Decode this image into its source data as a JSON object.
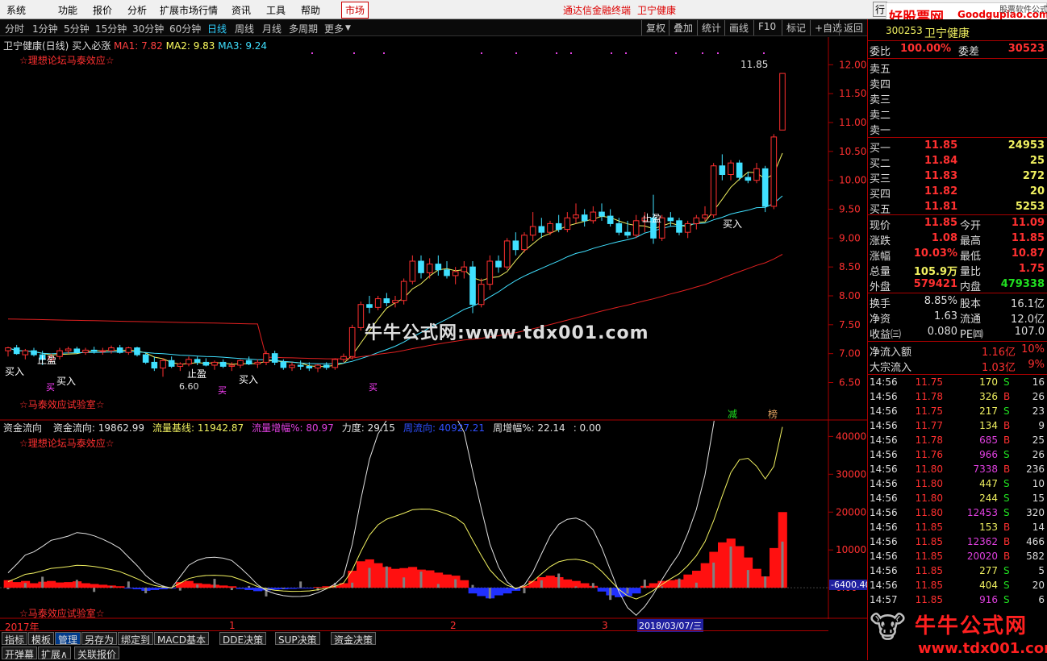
{
  "menu": {
    "items": [
      "系统",
      "功能",
      "报价",
      "分析",
      "扩展市场行情",
      "资讯",
      "工具",
      "帮助"
    ],
    "market": "市场",
    "center_title": "通达信金融终端",
    "center_stock": "卫宁健康",
    "right_button": "行",
    "logo_text": "好股票网",
    "logo_url": "Goodgupiao.com",
    "logo_sub": "股票软件公式"
  },
  "toolbar": {
    "periods": [
      "分时",
      "1分钟",
      "5分钟",
      "15分钟",
      "30分钟",
      "60分钟",
      "日线",
      "周线",
      "月线",
      "多周期",
      "更多"
    ],
    "active_period": "日线",
    "right_buttons": [
      "复权",
      "叠加",
      "统计",
      "画线",
      "F10",
      "标记",
      "+自选",
      "返回"
    ]
  },
  "chart_header": {
    "stock": "卫宁健康(日线)",
    "indicator": "买入必涨",
    "ma1": "MA1: 7.82",
    "ma2": "MA2: 9.83",
    "ma3": "MA3: 9.24",
    "forum": "☆理想论坛马泰效应☆",
    "lab": "☆马泰效应试验室☆",
    "watermark": "牛牛公式网:www.tdx001.com",
    "peak": "11.85",
    "low": "6.60",
    "tag_jian": "减",
    "tag_bang": "榜"
  },
  "price_axis": [
    "12.00",
    "11.50",
    "11.00",
    "10.50",
    "10.00",
    "9.50",
    "9.00",
    "8.50",
    "8.00",
    "7.50",
    "7.00",
    "6.50"
  ],
  "signals": {
    "buy": "买入",
    "stop": "止盈",
    "short_buy": "买"
  },
  "sub_header": {
    "name": "资金流向",
    "items": [
      {
        "text": "资金流向: 19862.99",
        "color": "#e0e0e0"
      },
      {
        "text": "流量基线: 11942.87",
        "color": "#f0f060"
      },
      {
        "text": "流量增幅%: 80.97",
        "color": "#e040e0"
      },
      {
        "text": "力度: 29.15",
        "color": "#e0e0e0"
      },
      {
        "text": "周流向: 40927.21",
        "color": "#3050ff"
      },
      {
        "text": "周增幅%: 22.14",
        "color": "#e0e0e0"
      },
      {
        "text": ": 0.00",
        "color": "#e0e0e0"
      }
    ],
    "forum": "☆理想论坛马泰效应☆",
    "lab": "☆马泰效应试验室☆"
  },
  "sub_axis": [
    "40000",
    "30000",
    "20000",
    "10000",
    "0.00"
  ],
  "sub_axis_neg": "-6400.40",
  "date_axis": {
    "year": "2017年",
    "m1": "1",
    "m2": "2",
    "m3": "3",
    "cursor": "2018/03/07/三"
  },
  "bottom_tabs": [
    "指标",
    "模板",
    "管理",
    "另存为",
    "绑定到",
    "MACD基本",
    "DDE决策",
    "SUP决策",
    "资金决策"
  ],
  "bottom_tabs2": [
    "开弹幕",
    "扩展∧",
    "关联报价"
  ],
  "quote": {
    "code": "300253",
    "name": "卫宁健康",
    "weibi_label": "委比",
    "weibi": "100.00%",
    "weicha_label": "委差",
    "weicha": "30523",
    "sells": [
      "卖五",
      "卖四",
      "卖三",
      "卖二",
      "卖一"
    ],
    "buys": [
      {
        "label": "买一",
        "price": "11.85",
        "vol": "24953"
      },
      {
        "label": "买二",
        "price": "11.84",
        "vol": "25"
      },
      {
        "label": "买三",
        "price": "11.83",
        "vol": "272"
      },
      {
        "label": "买四",
        "price": "11.82",
        "vol": "20"
      },
      {
        "label": "买五",
        "price": "11.81",
        "vol": "5253"
      }
    ],
    "stats": [
      {
        "l1": "现价",
        "v1": "11.85",
        "l2": "今开",
        "v2": "11.09",
        "c1": "#ff3030",
        "c2": "#ff3030"
      },
      {
        "l1": "涨跌",
        "v1": "1.08",
        "l2": "最高",
        "v2": "11.85",
        "c1": "#ff3030",
        "c2": "#ff3030"
      },
      {
        "l1": "涨幅",
        "v1": "10.03%",
        "l2": "最低",
        "v2": "10.87",
        "c1": "#ff3030",
        "c2": "#ff3030"
      },
      {
        "l1": "总量",
        "v1": "105.9万",
        "l2": "量比",
        "v2": "1.75",
        "c1": "#f0f060",
        "c2": "#ff3030"
      },
      {
        "l1": "外盘",
        "v1": "579421",
        "l2": "内盘",
        "v2": "479338",
        "c1": "#ff3030",
        "c2": "#20e020"
      }
    ],
    "stats2": [
      {
        "l1": "换手",
        "v1": "8.85%",
        "l2": "股本",
        "v2": "16.1亿"
      },
      {
        "l1": "净资",
        "v1": "1.63",
        "l2": "流通",
        "v2": "12.0亿"
      },
      {
        "l1": "收益㈢",
        "v1": "0.080",
        "l2": "PE㈣",
        "v2": "107.0"
      }
    ],
    "flow": [
      {
        "label": "净流入额",
        "v": "1.16亿",
        "p": "10%"
      },
      {
        "label": "大宗流入",
        "v": "1.03亿",
        "p": "9%"
      }
    ],
    "ticks": [
      [
        "14:56",
        "11.75",
        "170",
        "S",
        "16"
      ],
      [
        "14:56",
        "11.78",
        "326",
        "B",
        "26"
      ],
      [
        "14:56",
        "11.75",
        "217",
        "S",
        "23"
      ],
      [
        "14:56",
        "11.77",
        "134",
        "B",
        "9"
      ],
      [
        "14:56",
        "11.78",
        "685",
        "B",
        "25"
      ],
      [
        "14:56",
        "11.76",
        "966",
        "S",
        "26"
      ],
      [
        "14:56",
        "11.80",
        "7338",
        "B",
        "236"
      ],
      [
        "14:56",
        "11.80",
        "447",
        "S",
        "10"
      ],
      [
        "14:56",
        "11.80",
        "244",
        "S",
        "15"
      ],
      [
        "14:56",
        "11.80",
        "12453",
        "S",
        "320"
      ],
      [
        "14:56",
        "11.85",
        "153",
        "B",
        "14"
      ],
      [
        "14:56",
        "11.85",
        "12362",
        "B",
        "466"
      ],
      [
        "14:56",
        "11.85",
        "20020",
        "B",
        "582"
      ],
      [
        "14:56",
        "11.85",
        "277",
        "S",
        "5"
      ],
      [
        "14:56",
        "11.85",
        "404",
        "S",
        "20"
      ],
      [
        "14:57",
        "11.85",
        "916",
        "S",
        "6"
      ]
    ],
    "footer_logo": "牛牛公式网",
    "footer_url": "www.tdx001.com"
  },
  "chart_data": {
    "type": "candlestick",
    "title": "卫宁健康(日线)",
    "ylim": [
      6.2,
      12.2
    ],
    "candles": [
      [
        7.05,
        7.12,
        6.95,
        7.1
      ],
      [
        7.1,
        7.15,
        6.98,
        7.0
      ],
      [
        6.98,
        7.08,
        6.9,
        7.05
      ],
      [
        7.05,
        7.1,
        6.95,
        6.98
      ],
      [
        6.98,
        7.05,
        6.8,
        6.9
      ],
      [
        6.9,
        7.0,
        6.85,
        6.95
      ],
      [
        6.95,
        7.1,
        6.9,
        7.05
      ],
      [
        7.05,
        7.12,
        7.0,
        7.08
      ],
      [
        7.08,
        7.12,
        7.0,
        7.02
      ],
      [
        7.02,
        7.1,
        6.98,
        7.06
      ],
      [
        7.06,
        7.12,
        7.0,
        7.04
      ],
      [
        7.04,
        7.1,
        6.98,
        7.05
      ],
      [
        7.05,
        7.14,
        7.0,
        7.1
      ],
      [
        7.1,
        7.15,
        7.0,
        7.02
      ],
      [
        7.02,
        7.12,
        6.98,
        7.1
      ],
      [
        7.1,
        7.12,
        6.95,
        6.98
      ],
      [
        6.98,
        7.02,
        6.82,
        6.85
      ],
      [
        6.85,
        6.95,
        6.7,
        6.75
      ],
      [
        6.75,
        6.92,
        6.6,
        6.88
      ],
      [
        6.88,
        6.95,
        6.75,
        6.78
      ],
      [
        6.78,
        6.85,
        6.7,
        6.82
      ],
      [
        6.82,
        6.95,
        6.78,
        6.9
      ],
      [
        6.9,
        6.95,
        6.8,
        6.85
      ],
      [
        6.85,
        6.92,
        6.78,
        6.8
      ],
      [
        6.8,
        6.88,
        6.72,
        6.85
      ],
      [
        6.85,
        6.9,
        6.75,
        6.78
      ],
      [
        6.78,
        6.85,
        6.7,
        6.8
      ],
      [
        6.8,
        6.9,
        6.75,
        6.88
      ],
      [
        6.88,
        6.95,
        6.8,
        6.82
      ],
      [
        6.82,
        6.9,
        6.75,
        6.85
      ],
      [
        6.85,
        7.05,
        6.8,
        7.0
      ],
      [
        7.0,
        7.05,
        6.8,
        6.85
      ],
      [
        6.85,
        6.9,
        6.72,
        6.76
      ],
      [
        6.76,
        6.85,
        6.7,
        6.8
      ],
      [
        6.8,
        6.88,
        6.72,
        6.78
      ],
      [
        6.78,
        6.85,
        6.7,
        6.75
      ],
      [
        6.75,
        6.82,
        6.68,
        6.8
      ],
      [
        6.8,
        6.85,
        6.72,
        6.76
      ],
      [
        6.76,
        6.92,
        6.72,
        6.9
      ],
      [
        6.9,
        7.0,
        6.85,
        6.95
      ],
      [
        6.95,
        7.5,
        6.9,
        7.45
      ],
      [
        7.45,
        7.9,
        7.4,
        7.85
      ],
      [
        7.85,
        8.0,
        7.7,
        7.8
      ],
      [
        7.8,
        8.0,
        7.75,
        7.95
      ],
      [
        7.95,
        8.05,
        7.82,
        7.88
      ],
      [
        7.88,
        8.0,
        7.8,
        7.92
      ],
      [
        7.92,
        8.3,
        7.85,
        8.25
      ],
      [
        8.25,
        8.7,
        8.2,
        8.6
      ],
      [
        8.6,
        8.7,
        8.3,
        8.4
      ],
      [
        8.4,
        8.65,
        8.3,
        8.55
      ],
      [
        8.55,
        8.7,
        8.35,
        8.45
      ],
      [
        8.45,
        8.6,
        8.3,
        8.35
      ],
      [
        8.35,
        8.5,
        8.2,
        8.42
      ],
      [
        8.42,
        8.6,
        8.3,
        8.5
      ],
      [
        8.5,
        8.6,
        7.7,
        7.85
      ],
      [
        7.85,
        8.3,
        7.8,
        8.2
      ],
      [
        8.2,
        8.7,
        8.1,
        8.6
      ],
      [
        8.6,
        8.7,
        8.4,
        8.5
      ],
      [
        8.5,
        9.0,
        8.45,
        8.95
      ],
      [
        8.95,
        9.1,
        8.7,
        8.8
      ],
      [
        8.8,
        9.1,
        8.75,
        9.05
      ],
      [
        9.05,
        9.45,
        8.95,
        9.2
      ],
      [
        9.2,
        9.35,
        9.0,
        9.1
      ],
      [
        9.1,
        9.3,
        9.05,
        9.25
      ],
      [
        9.25,
        9.4,
        9.1,
        9.15
      ],
      [
        9.15,
        9.45,
        9.1,
        9.35
      ],
      [
        9.35,
        9.6,
        9.25,
        9.4
      ],
      [
        9.4,
        9.5,
        9.2,
        9.3
      ],
      [
        9.3,
        9.55,
        9.25,
        9.45
      ],
      [
        9.45,
        9.6,
        9.3,
        9.38
      ],
      [
        9.38,
        9.5,
        9.2,
        9.25
      ],
      [
        9.25,
        9.35,
        9.05,
        9.1
      ],
      [
        9.1,
        9.3,
        9.0,
        9.05
      ],
      [
        9.05,
        9.4,
        9.0,
        9.3
      ],
      [
        9.3,
        9.45,
        9.1,
        9.35
      ],
      [
        9.35,
        9.75,
        8.9,
        9.0
      ],
      [
        9.0,
        9.4,
        8.95,
        9.35
      ],
      [
        9.35,
        9.45,
        9.2,
        9.3
      ],
      [
        9.3,
        9.35,
        9.05,
        9.1
      ],
      [
        9.1,
        9.3,
        9.0,
        9.25
      ],
      [
        9.25,
        9.4,
        9.15,
        9.35
      ],
      [
        9.35,
        9.55,
        9.3,
        9.4
      ],
      [
        9.4,
        10.3,
        9.35,
        10.25
      ],
      [
        10.25,
        10.45,
        10.0,
        10.1
      ],
      [
        10.1,
        10.35,
        10.0,
        10.3
      ],
      [
        10.3,
        10.35,
        10.0,
        10.05
      ],
      [
        10.05,
        10.15,
        9.95,
        10.0
      ],
      [
        10.0,
        10.3,
        9.95,
        10.2
      ],
      [
        10.2,
        10.25,
        9.45,
        9.55
      ],
      [
        9.55,
        10.8,
        9.5,
        10.75
      ],
      [
        10.87,
        11.85,
        10.87,
        11.85
      ]
    ],
    "ma1_name": "MA1",
    "ma2_name": "MA2",
    "ma3_name": "MA3",
    "ma1_values_last": 7.82,
    "ma2_values_last": 9.83,
    "ma3_values_last": 9.24,
    "sub_chart": {
      "type": "bar",
      "series": [
        {
          "name": "资金流向",
          "values": [
            2000,
            1500,
            1800,
            1200,
            1600,
            1800,
            1400,
            1500,
            1700,
            1200,
            1000,
            800,
            600,
            400,
            -200,
            -400,
            -800,
            -600,
            -400,
            -200,
            1500,
            1800,
            1200,
            1000,
            800,
            600,
            400,
            -300,
            -600,
            -900,
            -700,
            -500,
            -400,
            -300,
            -200,
            -100,
            200,
            400,
            600,
            1200,
            4500,
            7000,
            7500,
            6500,
            5500,
            5000,
            5200,
            5500,
            4800,
            4600,
            4000,
            3500,
            3200,
            2000,
            -1500,
            -2200,
            -2800,
            -2000,
            -1500,
            -800,
            500,
            1800,
            2800,
            3200,
            2800,
            2200,
            1800,
            1200,
            500,
            -1000,
            -2000,
            -2500,
            -2200,
            -1500,
            500,
            1200,
            1800,
            2000,
            2200,
            3500,
            4500,
            6500,
            9500,
            12000,
            13000,
            11000,
            8000,
            5000,
            3000,
            10500,
            20000
          ]
        }
      ],
      "ylim": [
        -7000,
        42000
      ]
    }
  }
}
